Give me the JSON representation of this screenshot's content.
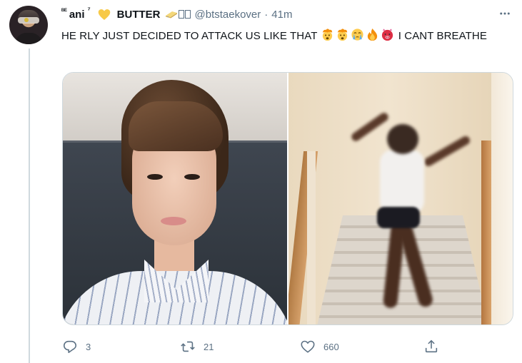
{
  "tweet": {
    "name_prefix": "ᴮᴱ",
    "name": "ani",
    "name_sup": "⁷",
    "name_butter": "BUTTER",
    "handle": "@btstaekover",
    "separator": "·",
    "time": "41m",
    "text_before_emoji": "HE RLY JUST DECIDED TO ATTACK US LIKE THAT ",
    "text_after_emoji": " I CANT BREATHE",
    "emojis": [
      "exploding-head",
      "exploding-head",
      "crying-face",
      "fire",
      "angry-face"
    ]
  },
  "actions": {
    "reply_count": "3",
    "retweet_count": "21",
    "like_count": "660"
  },
  "colors": {
    "secondary_text": "#5b7083",
    "heart": "#f7c948",
    "divider": "#cfd9de"
  },
  "icons": [
    "more-icon",
    "reply-icon",
    "retweet-icon",
    "like-icon",
    "share-icon",
    "yellow-heart-icon",
    "butter-icon"
  ]
}
